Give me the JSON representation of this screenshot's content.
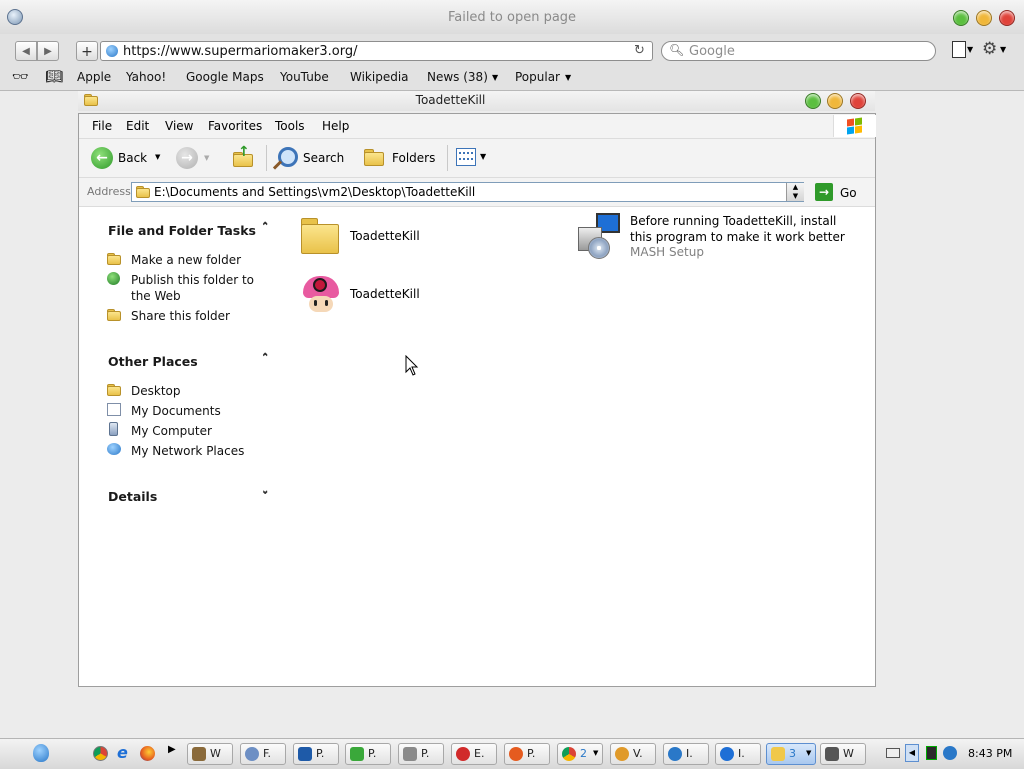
{
  "browser": {
    "title": "Failed to open page",
    "url": "https://www.supermariomaker3.org/",
    "search_placeholder": "Google",
    "bookmarks": [
      "Apple",
      "Yahoo!",
      "Google Maps",
      "YouTube",
      "Wikipedia",
      "News (38)",
      "Popular"
    ]
  },
  "explorer": {
    "title": "ToadetteKill",
    "menu": [
      "File",
      "Edit",
      "View",
      "Favorites",
      "Tools",
      "Help"
    ],
    "toolbar": {
      "back": "Back",
      "search": "Search",
      "folders": "Folders"
    },
    "address_label": "Address",
    "address_value": "E:\\Documents and Settings\\vm2\\Desktop\\ToadetteKill",
    "go_label": "Go",
    "panes": {
      "file_tasks": {
        "title": "File and Folder Tasks",
        "items": [
          "Make a new folder",
          "Publish this folder to the Web",
          "Share this folder"
        ]
      },
      "other_places": {
        "title": "Other Places",
        "items": [
          "Desktop",
          "My Documents",
          "My Computer",
          "My Network Places"
        ]
      },
      "details": {
        "title": "Details"
      }
    },
    "files": [
      {
        "name": "ToadetteKill",
        "icon": "folder-icon"
      },
      {
        "name": "ToadetteKill",
        "icon": "toadette-icon"
      },
      {
        "name": "Before running ToadetteKill, install this program to make it work better",
        "subtitle": "MASH Setup",
        "icon": "setup-installer-icon"
      }
    ]
  },
  "taskbar": {
    "buttons": [
      "W",
      "F.",
      "P.",
      "P.",
      "P.",
      "E.",
      "P.",
      "2",
      "V.",
      "I.",
      "I.",
      "3",
      "W"
    ],
    "clock": "8:43 PM"
  },
  "colors": {
    "accent": "#1e6fd6",
    "close": "#e0433a",
    "minimize": "#f0b73a",
    "zoom": "#5bbf3f"
  }
}
